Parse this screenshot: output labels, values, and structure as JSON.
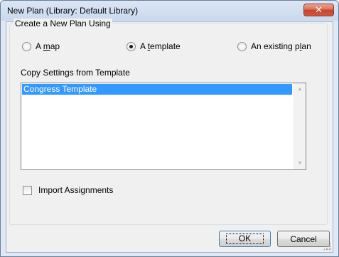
{
  "window": {
    "title": "New Plan (Library: Default Library)",
    "close_glyph": "✕"
  },
  "group": {
    "legend": "Create a New Plan Using",
    "options": [
      {
        "pre": "A ",
        "mn": "m",
        "post": "ap",
        "checked": false
      },
      {
        "pre": "A ",
        "mn": "t",
        "post": "emplate",
        "checked": true
      },
      {
        "pre": "An existing p",
        "mn": "l",
        "post": "an",
        "checked": false
      }
    ],
    "list_label": "Copy Settings from Template",
    "list_items": [
      "Congress Template"
    ],
    "import_label": "Import Assignments",
    "import_checked": false
  },
  "buttons": {
    "ok": "OK",
    "cancel": "Cancel"
  },
  "colors": {
    "selection": "#3399ff",
    "close_button": "#c7432c"
  },
  "icons": {
    "close": "close-icon",
    "scroll_up": "scroll-up-arrow-icon",
    "scroll_down": "scroll-down-arrow-icon",
    "resize": "resize-grip-icon"
  }
}
